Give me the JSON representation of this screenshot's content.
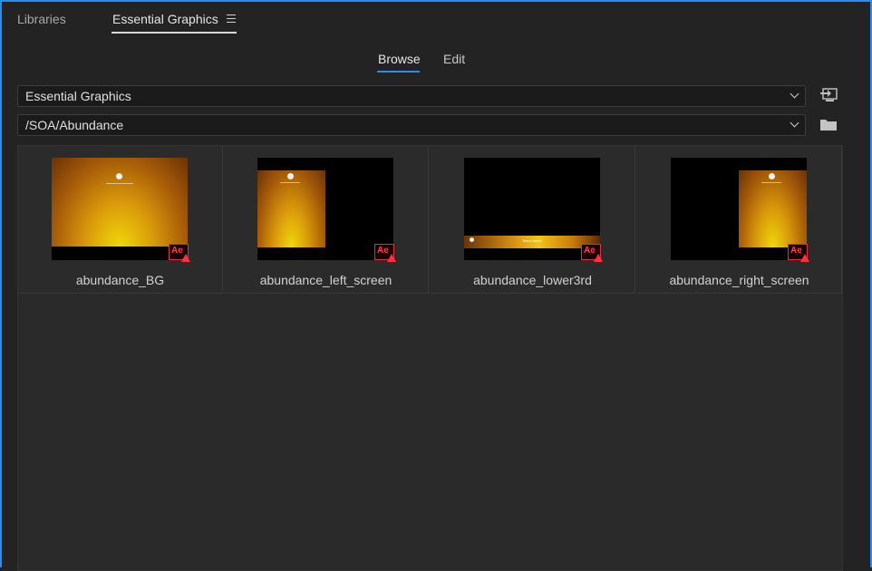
{
  "top_tabs": {
    "libraries": "Libraries",
    "essential_graphics": "Essential Graphics"
  },
  "mode_tabs": {
    "browse": "Browse",
    "edit": "Edit",
    "active": "browse"
  },
  "library_dropdown": {
    "value": "Essential Graphics"
  },
  "path_dropdown": {
    "value": "/SOA/Abundance"
  },
  "icons": {
    "panel_menu": "hamburger-menu-icon",
    "install": "install-template-icon",
    "folder": "folder-icon",
    "after_effects_badge": "Ae"
  },
  "templates": [
    {
      "name": "abundance_BG",
      "thumb": "full-gold-background"
    },
    {
      "name": "abundance_left_screen",
      "thumb": "left-gold-panel"
    },
    {
      "name": "abundance_lower3rd",
      "thumb": "lower-third-bar",
      "overlay_text": "Team Name"
    },
    {
      "name": "abundance_right_screen",
      "thumb": "right-gold-panel"
    }
  ],
  "colors": {
    "accent": "#2d8ceb",
    "warning": "#ff3b48",
    "panel_bg": "#232323"
  }
}
